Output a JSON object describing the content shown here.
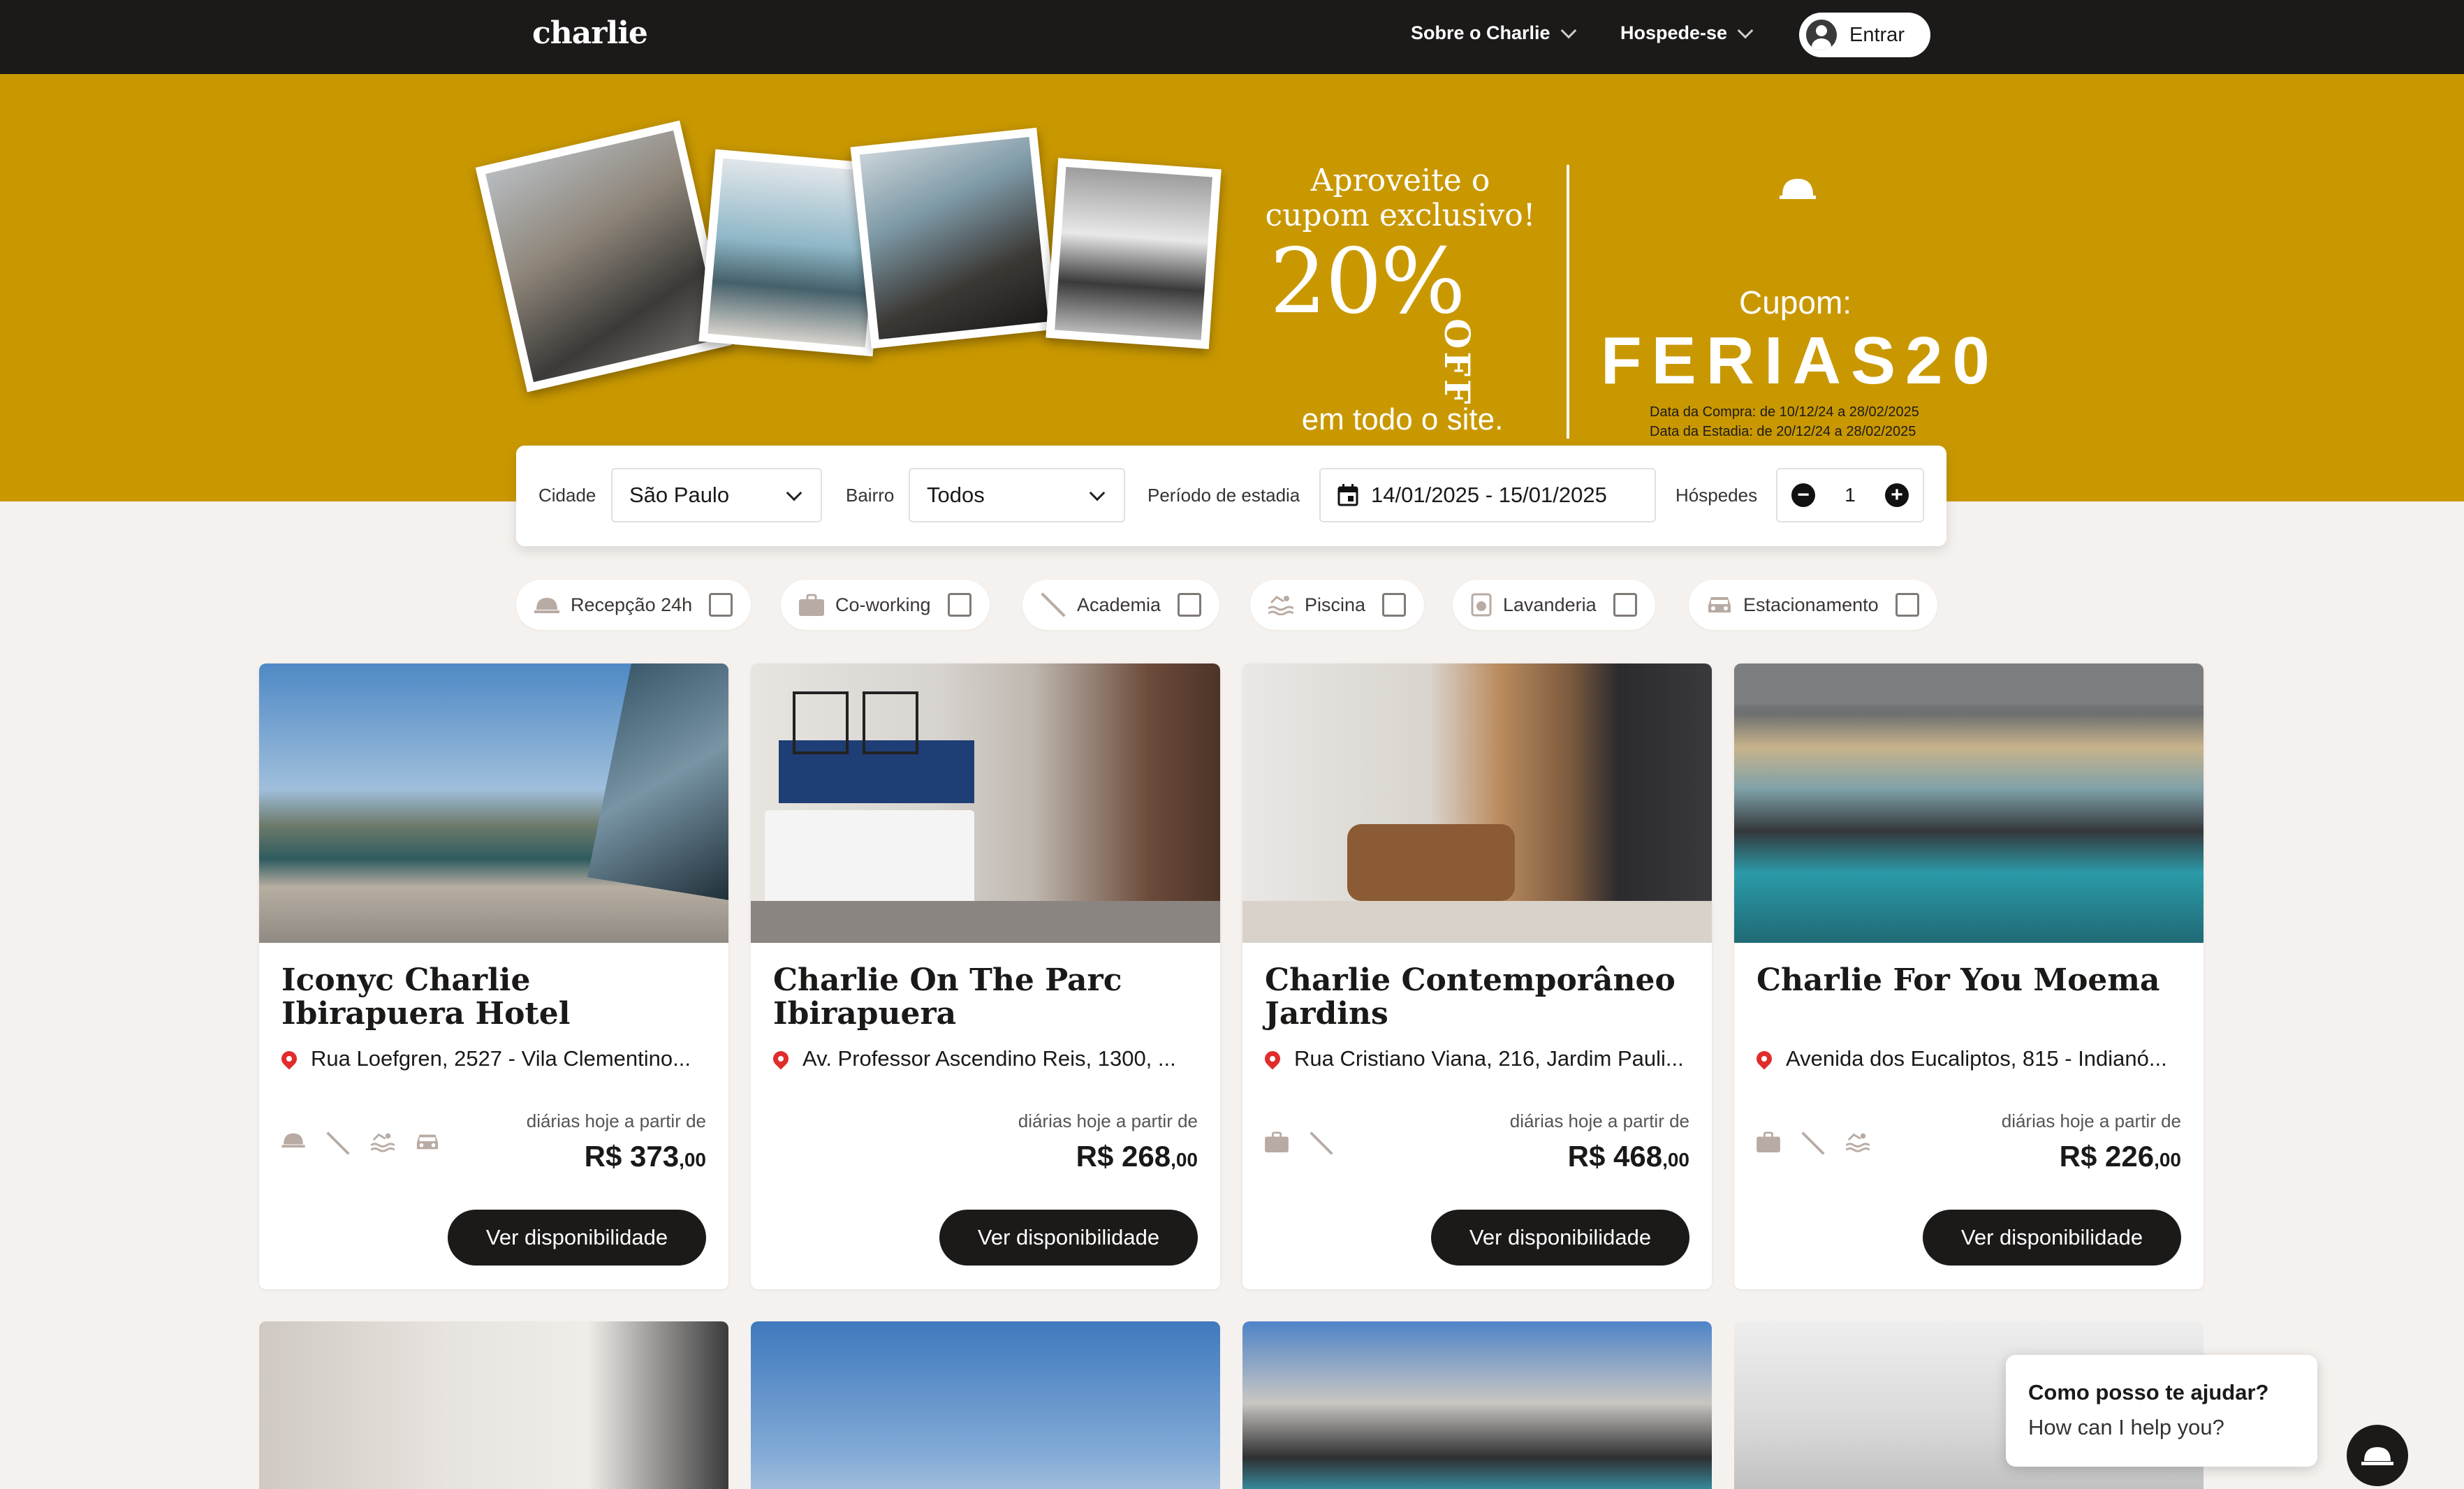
{
  "nav": {
    "logo": "charlie",
    "about": "Sobre o Charlie",
    "host": "Hospede-se",
    "login": "Entrar"
  },
  "banner": {
    "headline_1": "Aproveite o",
    "headline_2": "cupom exclusivo!",
    "discount": "20%",
    "off": "OFF",
    "subline": "em todo o site.",
    "coupon_label": "Cupom:",
    "coupon_code": "FERIAS20",
    "purchase_dates": "Data da Compra: de 10/12/24 a 28/02/2025",
    "stay_dates": "Data da Estadia: de 20/12/24 a 28/02/2025"
  },
  "search": {
    "city_label": "Cidade",
    "city_value": "São Paulo",
    "district_label": "Bairro",
    "district_value": "Todos",
    "period_label": "Período de estadia",
    "period_value": "14/01/2025 - 15/01/2025",
    "guests_label": "Hóspedes",
    "guests_value": "1",
    "minus": "−",
    "plus": "+"
  },
  "filters": [
    {
      "label": "Recepção 24h",
      "icon": "bell-icon"
    },
    {
      "label": "Co-working",
      "icon": "briefcase-icon"
    },
    {
      "label": "Academia",
      "icon": "dumbbell-icon"
    },
    {
      "label": "Piscina",
      "icon": "pool-icon"
    },
    {
      "label": "Lavanderia",
      "icon": "washer-icon"
    },
    {
      "label": "Estacionamento",
      "icon": "car-icon"
    }
  ],
  "cards": [
    {
      "title": "Iconyc Charlie Ibirapuera Hotel",
      "address": "Rua Loefgren, 2527 - Vila Clementino...",
      "from": "diárias hoje a partir de",
      "price": "R$ 373",
      "cents": ",00",
      "button": "Ver disponibilidade",
      "features": [
        "bell-icon",
        "dumbbell-icon",
        "pool-icon",
        "car-icon"
      ]
    },
    {
      "title": "Charlie On The Parc Ibirapuera",
      "address": "Av. Professor Ascendino Reis, 1300, ...",
      "from": "diárias hoje a partir de",
      "price": "R$ 268",
      "cents": ",00",
      "button": "Ver disponibilidade",
      "features": []
    },
    {
      "title": "Charlie Contemporâneo Jardins",
      "address": "Rua Cristiano Viana, 216, Jardim Pauli...",
      "from": "diárias hoje a partir de",
      "price": "R$ 468",
      "cents": ",00",
      "button": "Ver disponibilidade",
      "features": [
        "briefcase-icon",
        "dumbbell-icon"
      ]
    },
    {
      "title": "Charlie For You Moema",
      "address": "Avenida dos Eucaliptos, 815 - Indianó...",
      "from": "diárias hoje a partir de",
      "price": "R$ 226",
      "cents": ",00",
      "button": "Ver disponibilidade",
      "features": [
        "briefcase-icon",
        "dumbbell-icon",
        "pool-icon"
      ]
    }
  ],
  "chat": {
    "q1": "Como posso te ajudar?",
    "q2": "How can I help you?"
  },
  "colors": {
    "banner": "#c99801",
    "nav": "#1c1a19",
    "accent_pin": "#e12c2c"
  }
}
